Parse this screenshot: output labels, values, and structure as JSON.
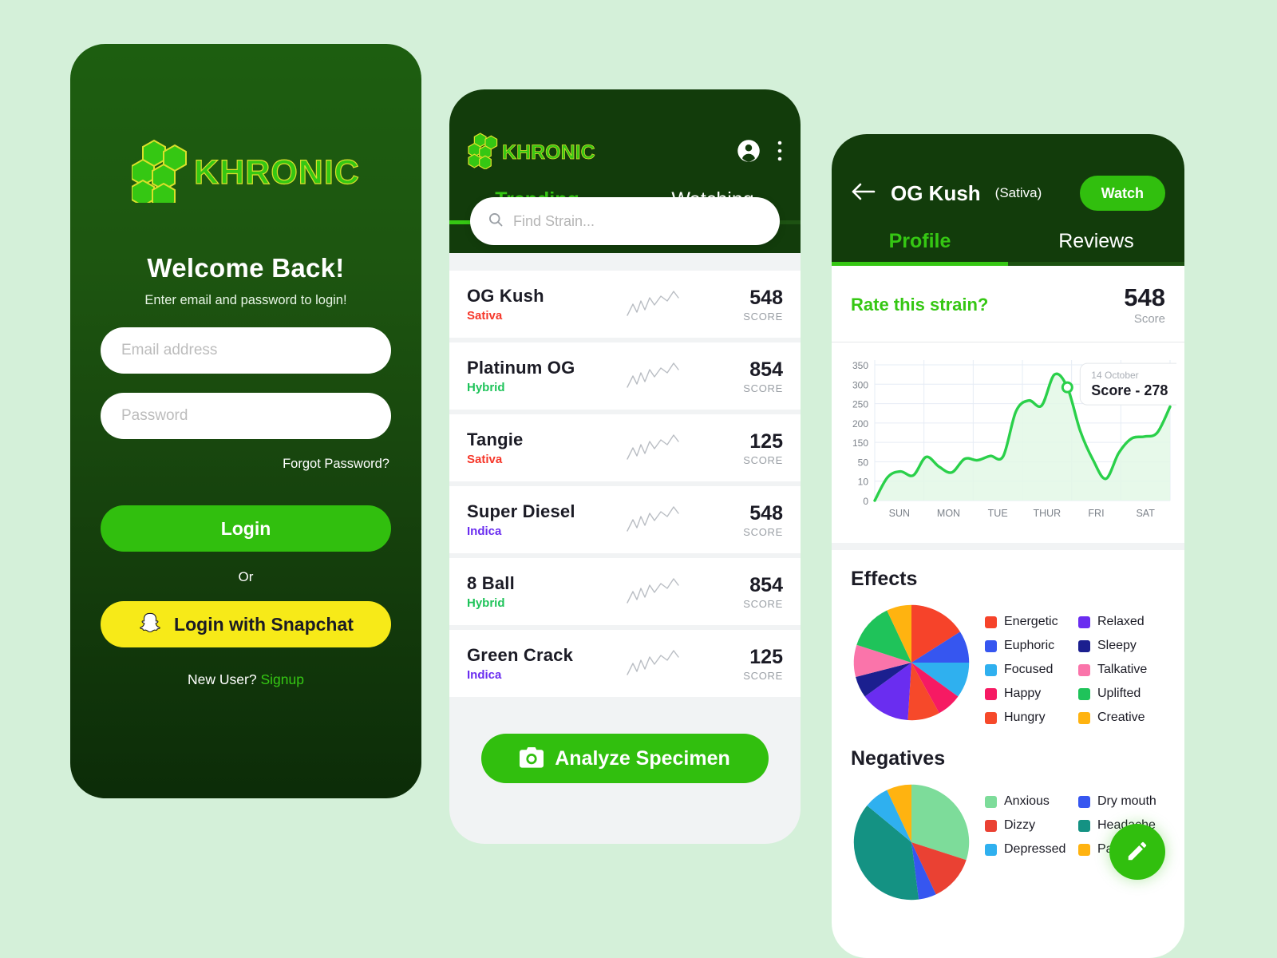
{
  "theme": {
    "page_bg": "#d4f0d9",
    "brand_green": "#35c713",
    "button_green": "#31bf0e",
    "dark_green": "#123c0b",
    "snapchat_yellow": "#f7ea18"
  },
  "login": {
    "brand": "KHRONIC",
    "logo_icon": "honeycomb-hexagons-logo",
    "heading": "Welcome Back!",
    "subheading": "Enter email and password to login!",
    "email": {
      "placeholder": "Email address",
      "value": ""
    },
    "password": {
      "placeholder": "Password",
      "value": ""
    },
    "forgot_password": "Forgot Password?",
    "login_button": "Login",
    "or": "Or",
    "snapchat_button": "Login with Snapchat",
    "snapchat_icon": "snapchat-ghost-icon",
    "new_user_prefix": "New User?",
    "signup_link": "Signup"
  },
  "trending": {
    "brand": "KHRONIC",
    "account_icon": "account-circle-icon",
    "overflow_icon": "more-vertical-icon",
    "tabs": [
      {
        "label": "Trending",
        "active": true
      },
      {
        "label": "Watching",
        "active": false
      }
    ],
    "search": {
      "placeholder": "Find Strain...",
      "value": "",
      "icon": "search-icon"
    },
    "score_label": "SCORE",
    "strains": [
      {
        "name": "OG Kush",
        "type": "Sativa",
        "type_color": "#f6372a",
        "score": "548"
      },
      {
        "name": "Platinum OG",
        "type": "Hybrid",
        "type_color": "#1fc35a",
        "score": "854"
      },
      {
        "name": "Tangie",
        "type": "Sativa",
        "type_color": "#f6372a",
        "score": "125"
      },
      {
        "name": "Super Diesel",
        "type": "Indica",
        "type_color": "#6a2df0",
        "score": "548"
      },
      {
        "name": "8 Ball",
        "type": "Hybrid",
        "type_color": "#1fc35a",
        "score": "854"
      },
      {
        "name": "Green Crack",
        "type": "Indica",
        "type_color": "#6a2df0",
        "score": "125"
      }
    ],
    "analyze_button": "Analyze Specimen",
    "analyze_icon": "camera-icon"
  },
  "detail": {
    "back_icon": "arrow-left-icon",
    "title": "OG Kush",
    "subtitle": "(Sativa)",
    "watch_button": "Watch",
    "tabs": [
      {
        "label": "Profile",
        "active": true
      },
      {
        "label": "Reviews",
        "active": false
      }
    ],
    "rate_prompt": "Rate this strain?",
    "score_value": "548",
    "score_label": "Score",
    "tooltip": {
      "date": "14 October",
      "text": "Score - 278"
    },
    "effects_title": "Effects",
    "negatives_title": "Negatives",
    "edit_fab_icon": "pencil-icon"
  },
  "chart_data": [
    {
      "type": "area",
      "title": "",
      "xlabel": "",
      "ylabel": "",
      "x": [
        "SUN",
        "MON",
        "TUE",
        "THUR",
        "FRI",
        "SAT"
      ],
      "ytick_labels": [
        "350",
        "300",
        "250",
        "200",
        "150",
        "50",
        "10",
        "0"
      ],
      "ylim": [
        0,
        350
      ],
      "grid": true,
      "line_color": "#2ad04a",
      "fill_color": "#e3f8e6",
      "highlight_point": {
        "x": "THUR",
        "y": 278,
        "label": "Score - 278",
        "date": "14 October"
      },
      "values": [
        0,
        18,
        30,
        22,
        75,
        40,
        28,
        65,
        58,
        80,
        78,
        230,
        258,
        245,
        325,
        292,
        180,
        60,
        15,
        95,
        160,
        165,
        175,
        242
      ]
    },
    {
      "type": "pie",
      "title": "Effects",
      "legend_position": "right",
      "categories": [
        "Energetic",
        "Euphoric",
        "Focused",
        "Happy",
        "Hungry",
        "Relaxed",
        "Sleepy",
        "Talkative",
        "Uplifted",
        "Creative"
      ],
      "values": [
        16,
        9,
        10,
        7,
        9,
        14,
        6,
        9,
        13,
        7
      ],
      "colors": [
        "#f6432a",
        "#3656f0",
        "#2fb0ef",
        "#f61a63",
        "#f6492a",
        "#6a2df0",
        "#1b1f8f",
        "#fa74aa",
        "#1fc35a",
        "#ffb310"
      ]
    },
    {
      "type": "pie",
      "title": "Negatives",
      "legend_position": "right",
      "categories": [
        "Anxious",
        "Dizzy",
        "Dry mouth",
        "Headache",
        "Depressed",
        "Paranoid"
      ],
      "values": [
        30,
        13,
        5,
        38,
        7,
        7
      ],
      "colors": [
        "#7ddc9a",
        "#ea4133",
        "#3656f0",
        "#149283",
        "#2fb0ef",
        "#ffb310"
      ]
    }
  ],
  "effects_legend": [
    {
      "label": "Energetic",
      "color": "#f6432a"
    },
    {
      "label": "Relaxed",
      "color": "#6a2df0"
    },
    {
      "label": "Euphoric",
      "color": "#3656f0"
    },
    {
      "label": "Sleepy",
      "color": "#1b1f8f"
    },
    {
      "label": "Focused",
      "color": "#2fb0ef"
    },
    {
      "label": "Talkative",
      "color": "#fa74aa"
    },
    {
      "label": "Happy",
      "color": "#f61a63"
    },
    {
      "label": "Uplifted",
      "color": "#1fc35a"
    },
    {
      "label": "Hungry",
      "color": "#f6492a"
    },
    {
      "label": "Creative",
      "color": "#ffb310"
    }
  ],
  "negatives_legend": [
    {
      "label": "Anxious",
      "color": "#7ddc9a"
    },
    {
      "label": "Dry mouth",
      "color": "#3656f0"
    },
    {
      "label": "Dizzy",
      "color": "#ea4133"
    },
    {
      "label": "Headache",
      "color": "#149283"
    },
    {
      "label": "Depressed",
      "color": "#2fb0ef"
    },
    {
      "label": "Paranoid",
      "color": "#ffb310"
    }
  ]
}
